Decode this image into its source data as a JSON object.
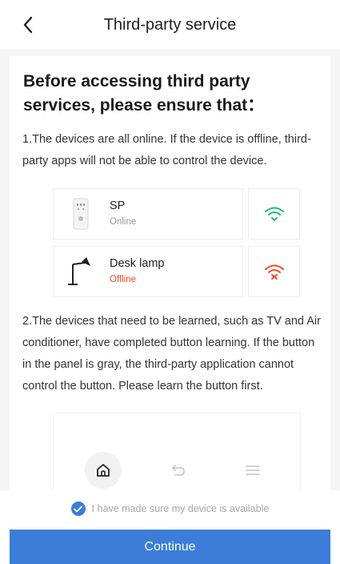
{
  "header": {
    "title": "Third-party service",
    "back_icon": "chevron-left-icon"
  },
  "intro": {
    "headline": "Before accessing third party services, please ensure that："
  },
  "step1": {
    "text": "1.The devices are all online. If the device is offline, third-party apps will not be able to control the device."
  },
  "devices": [
    {
      "name": "SP",
      "status": "Online",
      "icon": "smart-plug-icon",
      "wifi_icon": "wifi-online-icon",
      "status_color": "#9a9a9a",
      "wifi_color": "#1fb878"
    },
    {
      "name": "Desk lamp",
      "status": "Offline",
      "icon": "desk-lamp-icon",
      "wifi_icon": "wifi-offline-icon",
      "status_color": "#f04a23",
      "wifi_color": "#f04a23"
    }
  ],
  "step2": {
    "text": "2.The devices that need to be learned, such as TV and Air conditioner, have completed button learning. If the button in the panel is gray, the third-party application cannot control the button. Please learn the button first."
  },
  "panel": {
    "buttons": [
      "home-icon",
      "undo-icon",
      "menu-icon"
    ]
  },
  "footer": {
    "agree_text": "I have made sure my device is available",
    "agree_checked": true,
    "continue_label": "Continue"
  },
  "colors": {
    "accent": "#3b7dd8",
    "background": "#f5f5f5",
    "online_green": "#1fb878",
    "offline_red": "#f04a23"
  }
}
